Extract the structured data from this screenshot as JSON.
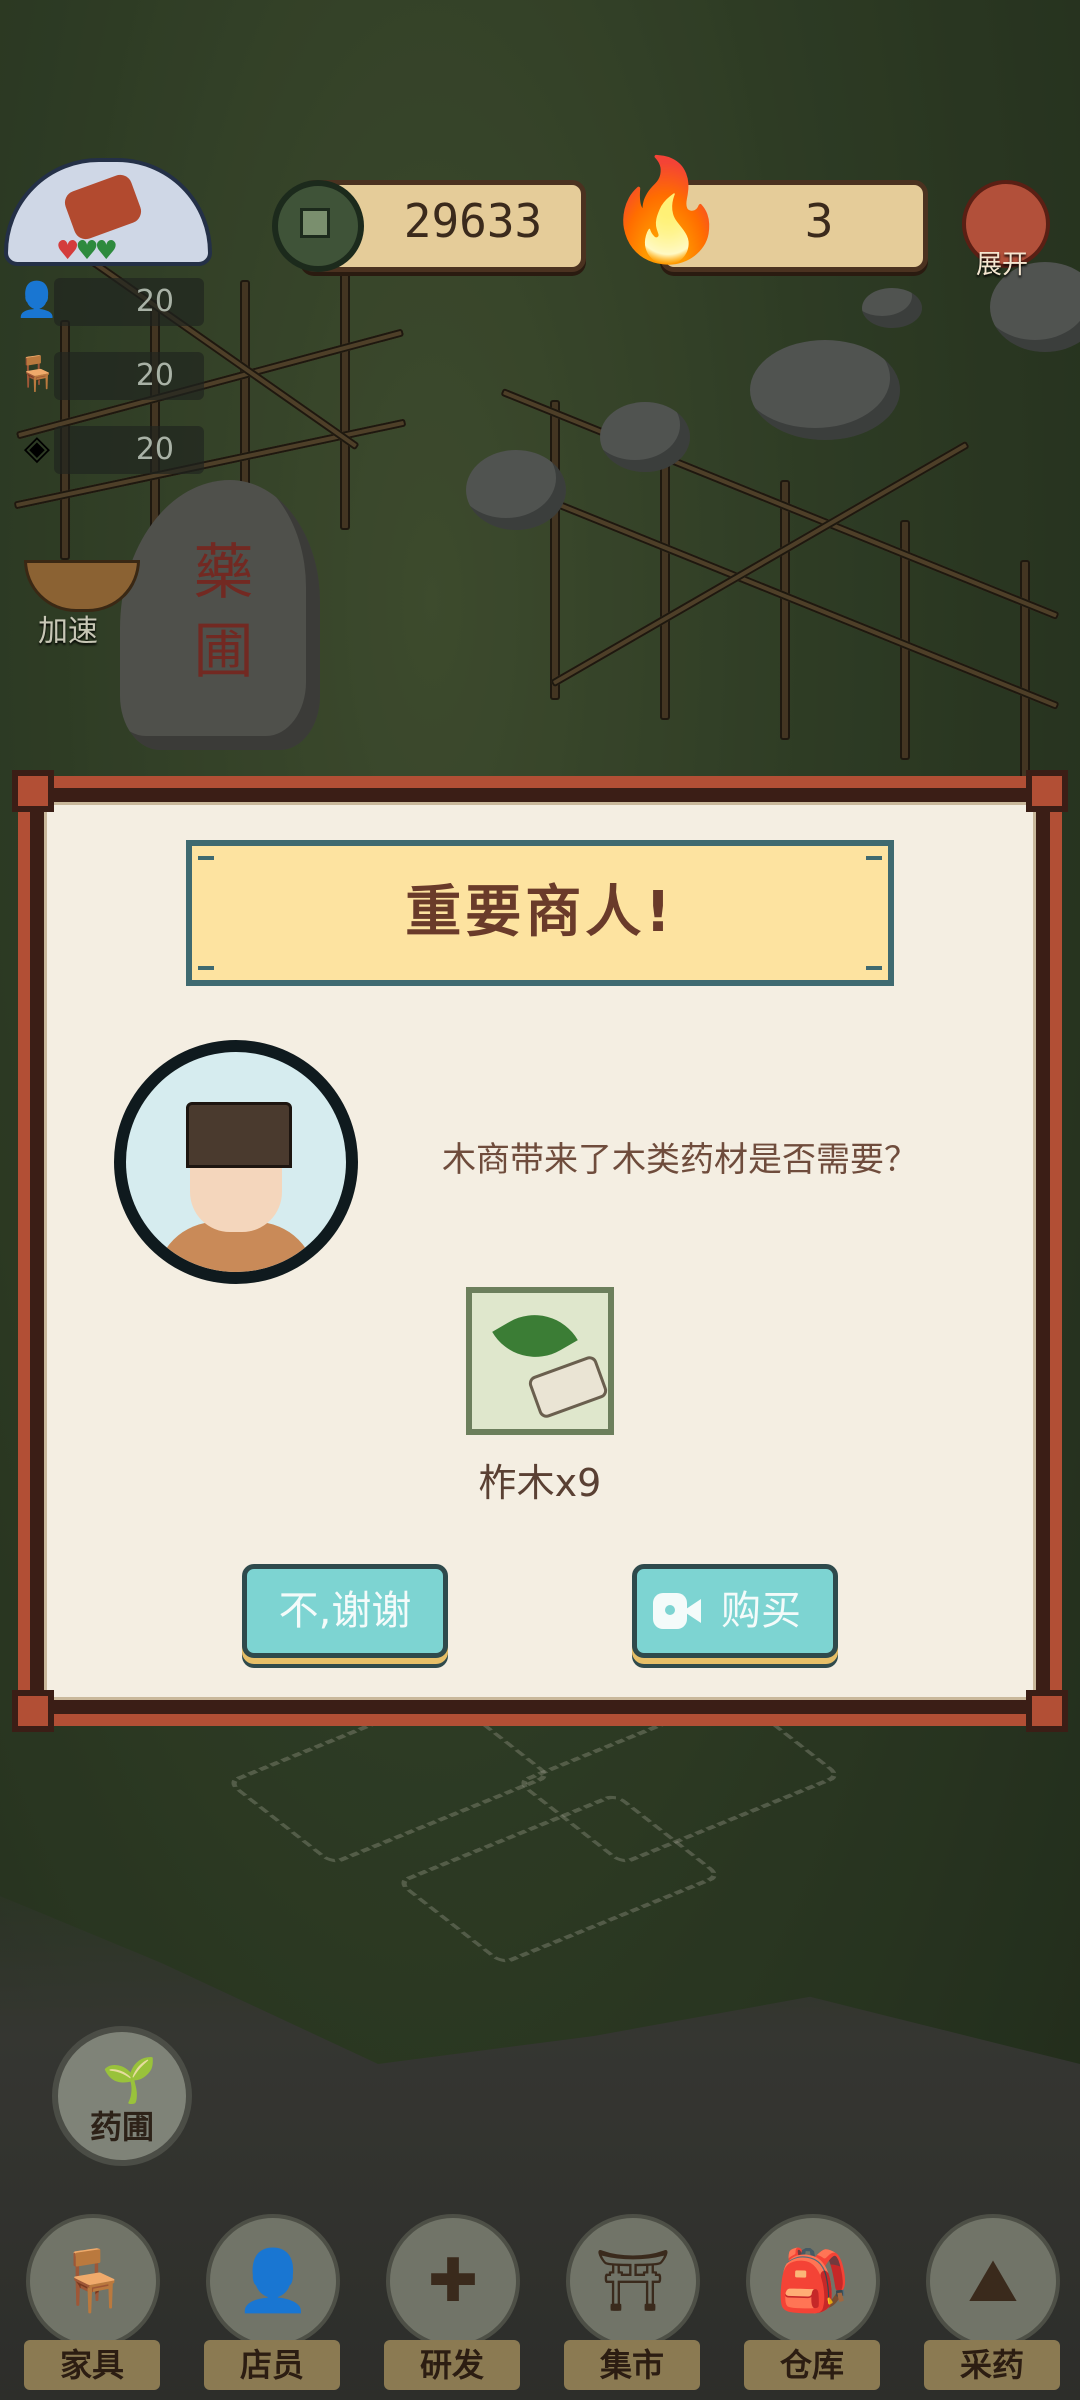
{
  "hud": {
    "coins": "29633",
    "fire_count": "3",
    "expand_label": "展开",
    "stats": [
      {
        "icon": "clerk-icon",
        "value": "20"
      },
      {
        "icon": "chair-icon",
        "value": "20"
      },
      {
        "icon": "herb-package-icon",
        "value": "20"
      }
    ],
    "speed_label": "加速",
    "stele_text": "藥 圃"
  },
  "dialog": {
    "title": "重要商人!",
    "message": "木商带来了木类药材是否需要？",
    "item_label": "柞木x9",
    "decline_label": "不,谢谢",
    "buy_label": "购买"
  },
  "bottom": {
    "herb_garden_label": "药圃",
    "nav": [
      {
        "label": "家具",
        "icon": "chair-icon",
        "glyph": "🪑"
      },
      {
        "label": "店员",
        "icon": "clerk-icon",
        "glyph": "👤"
      },
      {
        "label": "研发",
        "icon": "research-icon",
        "glyph": "✚"
      },
      {
        "label": "集市",
        "icon": "market-icon",
        "glyph": "⛩"
      },
      {
        "label": "仓库",
        "icon": "warehouse-icon",
        "glyph": "🎒"
      },
      {
        "label": "采药",
        "icon": "mountain-icon",
        "glyph": "⛰"
      }
    ]
  },
  "colors": {
    "dialog_frame": "#b24f35",
    "banner": "#fde3a0",
    "button": "#7dd4d2"
  }
}
